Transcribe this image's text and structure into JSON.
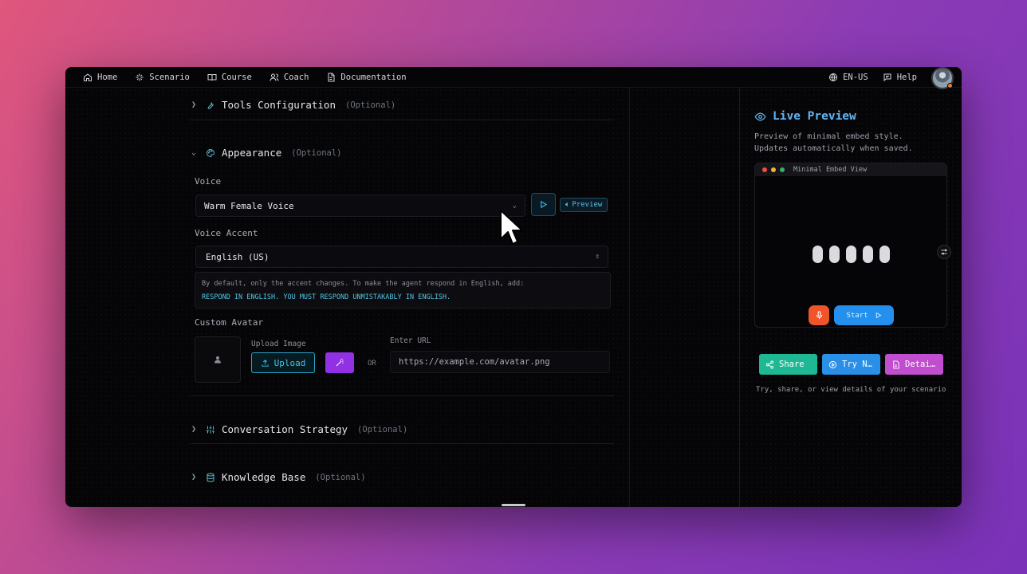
{
  "nav": {
    "items": [
      {
        "label": "Home",
        "icon": "home-icon"
      },
      {
        "label": "Scenario",
        "icon": "sparkle-icon"
      },
      {
        "label": "Course",
        "icon": "book-icon"
      },
      {
        "label": "Coach",
        "icon": "users-icon"
      },
      {
        "label": "Documentation",
        "icon": "document-icon"
      }
    ],
    "language": "EN-US",
    "help": "Help"
  },
  "sections": {
    "tools": {
      "title": "Tools Configuration",
      "optional": "(Optional)"
    },
    "appearance": {
      "title": "Appearance",
      "optional": "(Optional)"
    },
    "strategy": {
      "title": "Conversation Strategy",
      "optional": "(Optional)"
    },
    "knowledge": {
      "title": "Knowledge Base",
      "optional": "(Optional)"
    }
  },
  "appearance": {
    "voice_label": "Voice",
    "voice_value": "Warm Female Voice",
    "preview_label": "Preview",
    "accent_label": "Voice Accent",
    "accent_value": "English (US)",
    "note_line1": "By default, only the accent changes. To make the agent respond in English, add:",
    "note_line2": "RESPOND IN ENGLISH. YOU MUST RESPOND UNMISTAKABLY IN ENGLISH.",
    "avatar_label": "Custom Avatar",
    "upload_image_label": "Upload Image",
    "upload_button": "Upload",
    "or_text": "OR",
    "url_label": "Enter URL",
    "url_placeholder": "https://example.com/avatar.png"
  },
  "preview": {
    "title": "Live Preview",
    "subtitle": "Preview of minimal embed style. Updates automatically when saved.",
    "embed_title": "Minimal Embed View",
    "start_label": "Start",
    "share_label": "Share",
    "try_label": "Try N…",
    "details_label": "Detai…",
    "footer": "Try, share, or view details of your scenario"
  },
  "colors": {
    "accent_cyan": "#47c4e5",
    "preview_title": "#63b5f5",
    "share": "#1fb894",
    "try": "#2a8fe6",
    "details": "#c14dcf",
    "mic": "#f0542a",
    "start": "#2390ee",
    "magic": "#9230e6"
  }
}
